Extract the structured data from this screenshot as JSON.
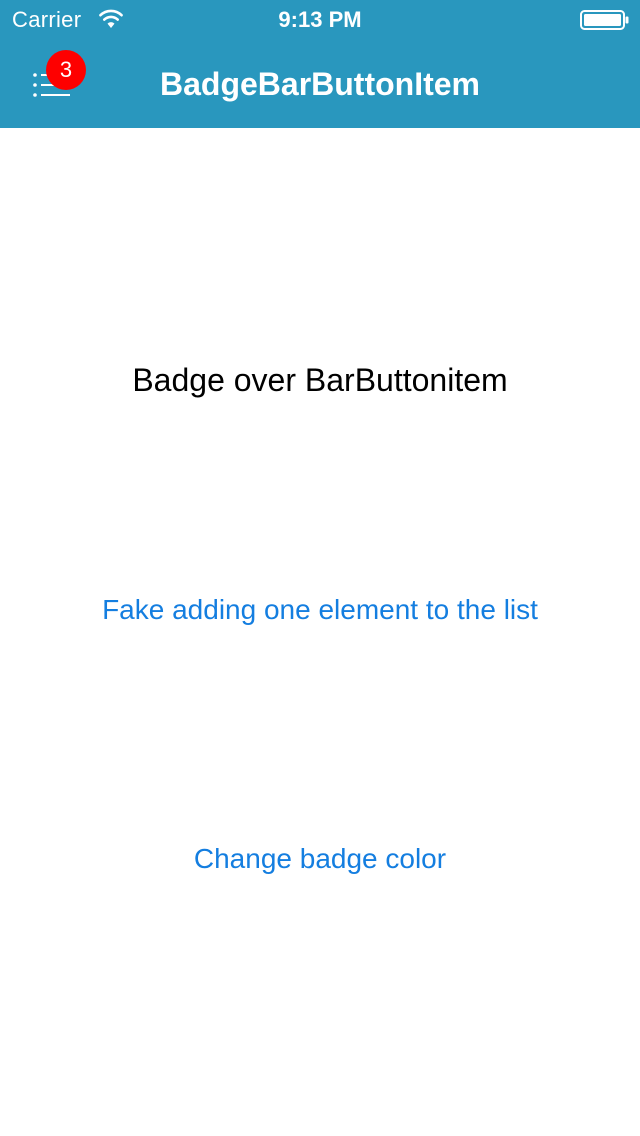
{
  "status_bar": {
    "carrier": "Carrier",
    "time": "9:13 PM",
    "wifi_icon": "wifi-icon",
    "battery_icon": "battery-icon"
  },
  "nav_bar": {
    "title": "BadgeBarButtonItem",
    "menu_icon": "list-icon",
    "badge_count": "3",
    "badge_color": "#fe0000",
    "background_color": "#2997be"
  },
  "content": {
    "label": "Badge over BarButtonitem",
    "add_button": "Fake adding one element to the list",
    "color_button": "Change badge color",
    "link_color": "#147ee0"
  }
}
